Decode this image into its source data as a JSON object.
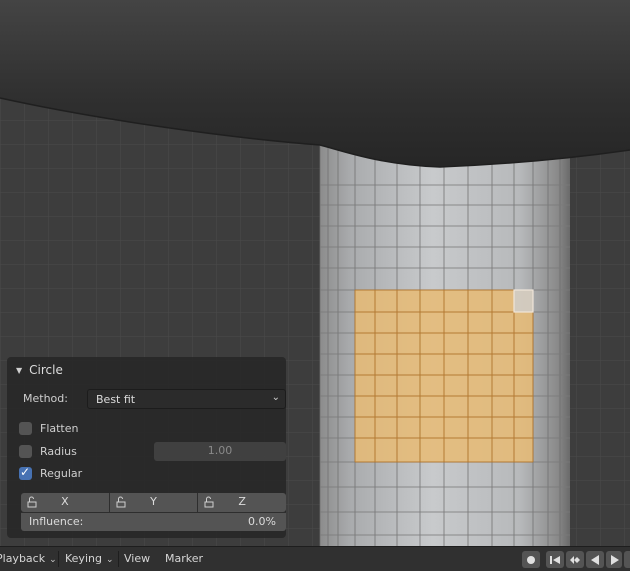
{
  "operator_panel": {
    "title": "Circle",
    "method_label": "Method:",
    "method_value": "Best fit",
    "flatten": {
      "label": "Flatten",
      "checked": false
    },
    "radius": {
      "label": "Radius",
      "checked": false,
      "value": "1.00"
    },
    "regular": {
      "label": "Regular",
      "checked": true
    },
    "lock_axes": [
      "X",
      "Y",
      "Z"
    ],
    "influence_label": "Influence:",
    "influence_value": "0.0%"
  },
  "timeline": {
    "playback": "Playback",
    "keying": "Keying",
    "view": "View",
    "marker": "Marker",
    "controls": [
      "record-icon",
      "jump-start-icon",
      "prev-keyframe-icon",
      "play-reverse-icon",
      "play-icon"
    ]
  },
  "colors": {
    "selection_fill": "#e7bb74",
    "accent_checkbox": "#4772b3",
    "panel_bg": "#282828"
  }
}
